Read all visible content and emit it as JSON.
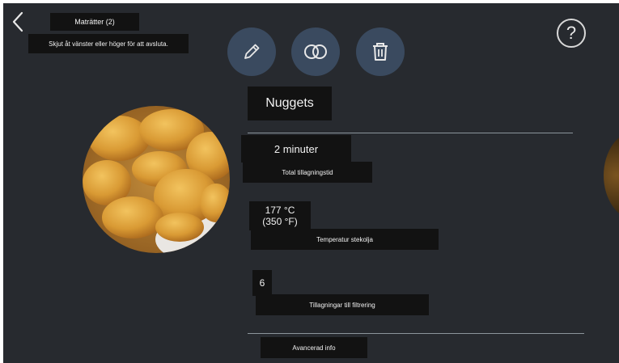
{
  "header": {
    "title": "Maträtter (2)",
    "hint": "Skjut åt vänster eller höger för att avsluta."
  },
  "toolbar": {
    "edit_icon": "pencil-icon",
    "compare_icon": "overlap-circles-icon",
    "delete_icon": "trash-icon",
    "help_label": "?"
  },
  "dish": {
    "name": "Nuggets",
    "image": "chicken-nuggets-photo",
    "cook_time": "2 minuter",
    "cook_time_label": "Total tillagningstid",
    "temp_line1": "177 °C",
    "temp_line2": "(350 °F)",
    "temp_label": "Temperatur stekolja",
    "filter_count": "6",
    "filter_label": "Tillagningar till filtrering",
    "advanced_label": "Avancerad info"
  },
  "colors": {
    "background": "#272a2f",
    "button": "#3a4a5f",
    "label_block": "#121212",
    "divider": "#8b959b"
  }
}
